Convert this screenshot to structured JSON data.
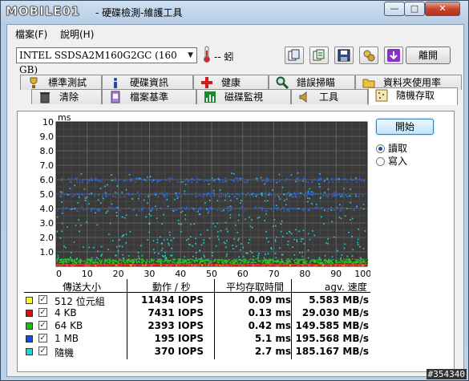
{
  "window": {
    "logo": "MOBILE01",
    "title": "- 硬碟檢測-維護工具",
    "minimize_glyph": "—",
    "maximize_glyph": "□",
    "close_glyph": "✕"
  },
  "menu": [
    {
      "label": "檔案(F)"
    },
    {
      "label": "說明(H)"
    }
  ],
  "toolbar": {
    "drive": "INTEL SSDSA2M160G2GC (160 GB)",
    "temperature": "-- 蚓",
    "exit_label": "離開",
    "icons": [
      "copy-icon",
      "copy-text-icon",
      "save-icon",
      "options-icon",
      "download-icon"
    ]
  },
  "tabs": {
    "top": [
      {
        "label": "標準測試",
        "icon": "trophy-icon"
      },
      {
        "label": "硬碟資訊",
        "icon": "info-icon"
      },
      {
        "label": "健康",
        "icon": "health-cross-icon"
      },
      {
        "label": "錯誤掃瞄",
        "icon": "magnifier-icon"
      },
      {
        "label": "資料夾使用率",
        "icon": "folder-icon"
      }
    ],
    "bottom": [
      {
        "label": "清除",
        "icon": "trash-icon"
      },
      {
        "label": "檔案基準",
        "icon": "file-benchmark-icon"
      },
      {
        "label": "磁碟監視",
        "icon": "monitor-chart-icon"
      },
      {
        "label": "工具",
        "icon": "speaker-tools-icon"
      },
      {
        "label": "隨機存取",
        "icon": "random-access-icon"
      }
    ]
  },
  "controls": {
    "start_label": "開始",
    "read_label": "讀取",
    "write_label": "寫入",
    "selected": "read"
  },
  "chart_data": {
    "type": "scatter",
    "ylabel": "ms",
    "ylim": [
      0,
      10
    ],
    "y_ticks": [
      "1.0",
      "2.0",
      "3.0",
      "4.0",
      "5.0",
      "6.0",
      "7.0",
      "8.0",
      "9.0",
      "10"
    ],
    "x_ticks": [
      "0",
      "10",
      "20",
      "30",
      "40",
      "50",
      "60",
      "70",
      "80",
      "90",
      "100%"
    ],
    "xlim": [
      0,
      100
    ],
    "grid": true,
    "background": "#3a3a3a",
    "series": [
      {
        "name": "512 位元組",
        "color": "#ffff00",
        "band": [
          0.05,
          0.15
        ]
      },
      {
        "name": "4 KB",
        "color": "#ff2020",
        "band": [
          0.1,
          0.2
        ]
      },
      {
        "name": "64 KB",
        "color": "#22cc22",
        "band": [
          0.25,
          0.55
        ]
      },
      {
        "name": "1 MB",
        "color": "#2a6af0",
        "band": [
          3.9,
          6.2
        ]
      },
      {
        "name": "隨機",
        "color": "#22d8d8",
        "band": [
          0.6,
          6.5
        ]
      }
    ]
  },
  "table": {
    "headers": [
      "傳送大小",
      "動作 / 秒",
      "平均存取時間",
      "agv. 速度"
    ],
    "rows": [
      {
        "label": "512 位元組",
        "color": "#ffff00",
        "checked": "✓",
        "ops": "11434 IOPS",
        "latency": "0.09 ms",
        "speed": "5.583 MB/s"
      },
      {
        "label": "4 KB",
        "color": "#ff0000",
        "checked": "✓",
        "ops": "7431 IOPS",
        "latency": "0.13 ms",
        "speed": "29.030 MB/s"
      },
      {
        "label": "64 KB",
        "color": "#00cc00",
        "checked": "✓",
        "ops": "2393 IOPS",
        "latency": "0.42 ms",
        "speed": "149.585 MB/s"
      },
      {
        "label": "1 MB",
        "color": "#0050ff",
        "checked": "✓",
        "ops": "195 IOPS",
        "latency": "5.1 ms",
        "speed": "195.568 MB/s"
      },
      {
        "label": "隨機",
        "color": "#00e0e0",
        "checked": "✓",
        "ops": "370 IOPS",
        "latency": "2.7 ms",
        "speed": "185.167 MB/s"
      }
    ]
  },
  "watermark": "#354340"
}
